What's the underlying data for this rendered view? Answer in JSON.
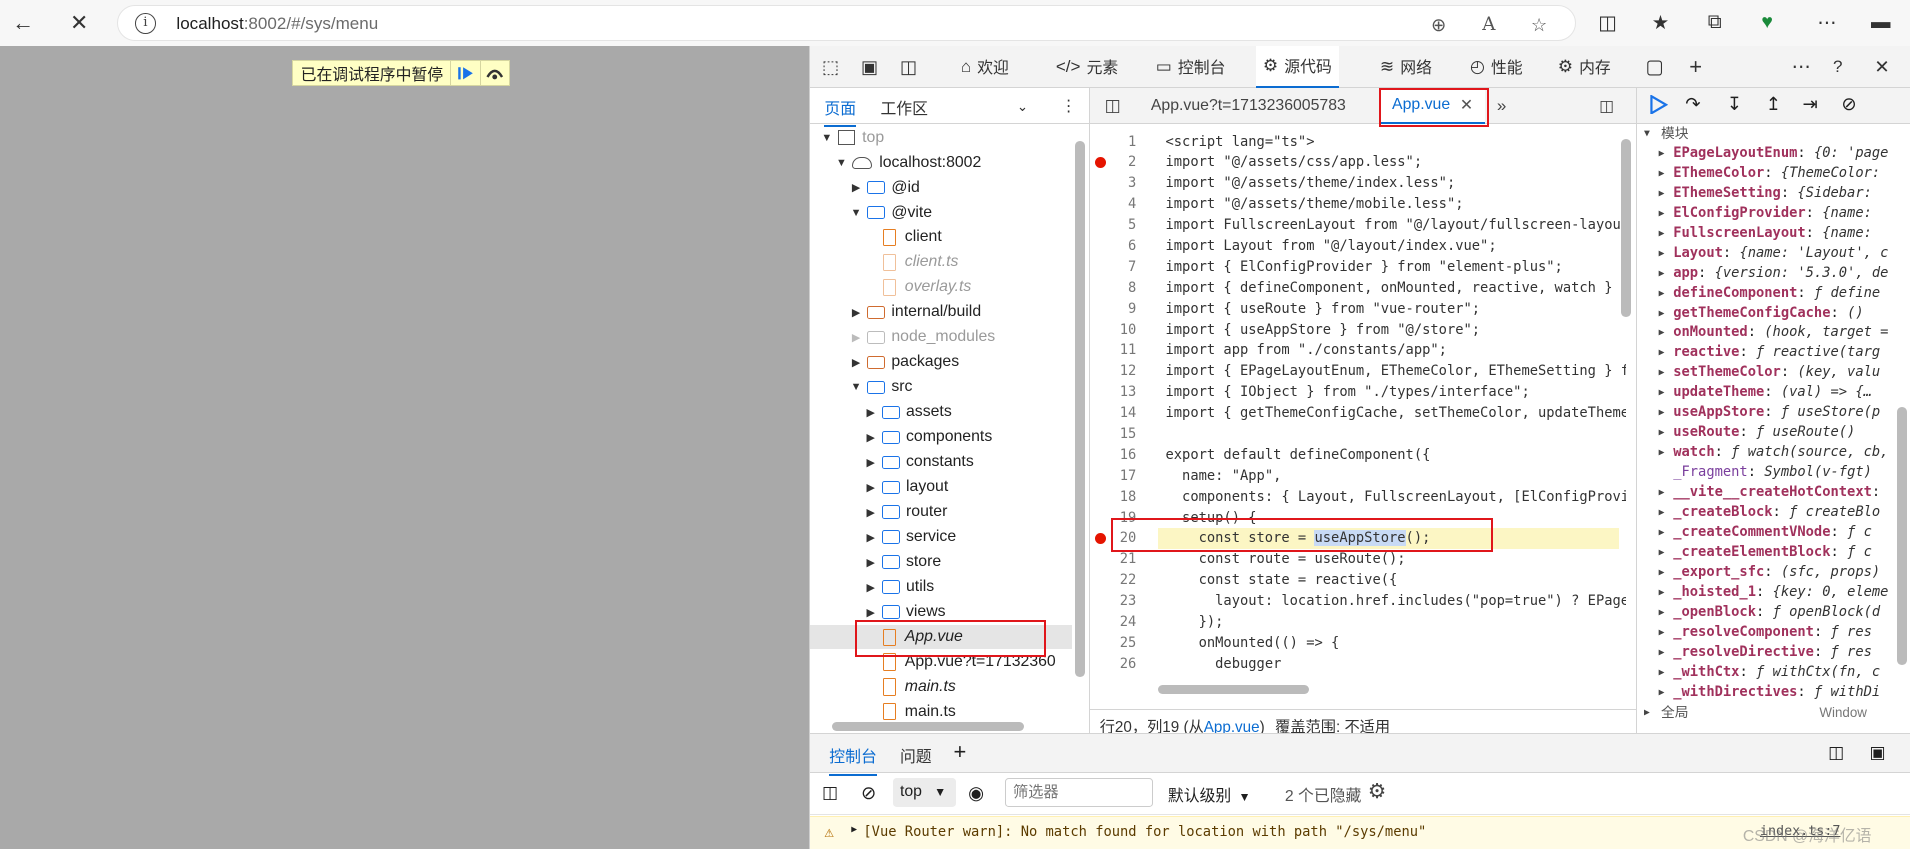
{
  "browser": {
    "url_host": "localhost",
    "url_path": ":8002/#/sys/menu",
    "icons": {
      "back": "back-arrow-icon",
      "stop": "close-icon",
      "info": "info-icon"
    }
  },
  "page": {
    "paused_label": "已在调试程序中暂停"
  },
  "devtools": {
    "tabs": [
      {
        "label": "欢迎",
        "icon": "home-icon"
      },
      {
        "label": "元素",
        "icon": "code-icon"
      },
      {
        "label": "控制台",
        "icon": "console-icon"
      },
      {
        "label": "源代码",
        "icon": "sources-icon"
      },
      {
        "label": "网络",
        "icon": "wifi-icon"
      },
      {
        "label": "性能",
        "icon": "performance-icon"
      },
      {
        "label": "内存",
        "icon": "memory-icon"
      }
    ],
    "active_tab": "源代码"
  },
  "navigator": {
    "tabs": [
      "页面",
      "工作区"
    ],
    "tree": [
      {
        "label": "top",
        "type": "frame",
        "depth": 0,
        "arrow": "down"
      },
      {
        "label": "localhost:8002",
        "type": "cloud",
        "depth": 1,
        "arrow": "down"
      },
      {
        "label": "@id",
        "type": "folder",
        "depth": 2,
        "arrow": "right"
      },
      {
        "label": "@vite",
        "type": "folder",
        "depth": 2,
        "arrow": "down"
      },
      {
        "label": "client",
        "type": "file",
        "depth": 3
      },
      {
        "label": "client.ts",
        "type": "file-dim",
        "depth": 3
      },
      {
        "label": "overlay.ts",
        "type": "file-dim",
        "depth": 3
      },
      {
        "label": "internal/build",
        "type": "folder-orange",
        "depth": 2,
        "arrow": "right"
      },
      {
        "label": "node_modules",
        "type": "folder-gray",
        "depth": 2,
        "arrow": "right"
      },
      {
        "label": "packages",
        "type": "folder-orange",
        "depth": 2,
        "arrow": "right"
      },
      {
        "label": "src",
        "type": "folder",
        "depth": 2,
        "arrow": "down"
      },
      {
        "label": "assets",
        "type": "folder",
        "depth": 3,
        "arrow": "right"
      },
      {
        "label": "components",
        "type": "folder",
        "depth": 3,
        "arrow": "right"
      },
      {
        "label": "constants",
        "type": "folder",
        "depth": 3,
        "arrow": "right"
      },
      {
        "label": "layout",
        "type": "folder",
        "depth": 3,
        "arrow": "right"
      },
      {
        "label": "router",
        "type": "folder",
        "depth": 3,
        "arrow": "right"
      },
      {
        "label": "service",
        "type": "folder",
        "depth": 3,
        "arrow": "right"
      },
      {
        "label": "store",
        "type": "folder",
        "depth": 3,
        "arrow": "right"
      },
      {
        "label": "utils",
        "type": "folder",
        "depth": 3,
        "arrow": "right"
      },
      {
        "label": "views",
        "type": "folder",
        "depth": 3,
        "arrow": "right"
      },
      {
        "label": "App.vue",
        "type": "file-italic",
        "depth": 3,
        "selected": true
      },
      {
        "label": "App.vue?t=17132360",
        "type": "file",
        "depth": 3
      },
      {
        "label": "main.ts",
        "type": "file-italic",
        "depth": 3
      },
      {
        "label": "main.ts",
        "type": "file",
        "depth": 3
      }
    ]
  },
  "editor": {
    "tabs": [
      {
        "label": "App.vue?t=1713236005783"
      },
      {
        "label": "App.vue",
        "active": true
      }
    ],
    "lines": [
      {
        "n": "1",
        "text": "<script lang=\"ts\">"
      },
      {
        "n": "2",
        "text": "import \"@/assets/css/app.less\";",
        "bp": true
      },
      {
        "n": "3",
        "text": "import \"@/assets/theme/index.less\";"
      },
      {
        "n": "4",
        "text": "import \"@/assets/theme/mobile.less\";"
      },
      {
        "n": "5",
        "text": "import FullscreenLayout from \"@/layout/fullscreen-layout."
      },
      {
        "n": "6",
        "text": "import Layout from \"@/layout/index.vue\";"
      },
      {
        "n": "7",
        "text": "import { ElConfigProvider } from \"element-plus\";"
      },
      {
        "n": "8",
        "text": "import { defineComponent, onMounted, reactive, watch } f"
      },
      {
        "n": "9",
        "text": "import { useRoute } from \"vue-router\";"
      },
      {
        "n": "10",
        "text": "import { useAppStore } from \"@/store\";"
      },
      {
        "n": "11",
        "text": "import app from \"./constants/app\";"
      },
      {
        "n": "12",
        "text": "import { EPageLayoutEnum, EThemeColor, EThemeSetting } f"
      },
      {
        "n": "13",
        "text": "import { IObject } from \"./types/interface\";"
      },
      {
        "n": "14",
        "text": "import { getThemeConfigCache, setThemeColor, updateTheme"
      },
      {
        "n": "15",
        "text": ""
      },
      {
        "n": "16",
        "text": "export default defineComponent({"
      },
      {
        "n": "17",
        "text": "  name: \"App\","
      },
      {
        "n": "18",
        "text": "  components: { Layout, FullscreenLayout, [ElConfigProvi"
      },
      {
        "n": "19",
        "text": "  setup() {"
      },
      {
        "n": "20",
        "text": "    const store = useAppStore();",
        "bp": true,
        "hl": true
      },
      {
        "n": "21",
        "text": "    const route = useRoute();"
      },
      {
        "n": "22",
        "text": "    const state = reactive({"
      },
      {
        "n": "23",
        "text": "      layout: location.href.includes(\"pop=true\") ? EPageL"
      },
      {
        "n": "24",
        "text": "    });"
      },
      {
        "n": "25",
        "text": "    onMounted(() => {"
      },
      {
        "n": "26",
        "text": "      debugger"
      }
    ],
    "status": {
      "pos": "行20，列19 (从",
      "file": "App.vue",
      "close": ")",
      "coverage": "覆盖范围: 不适用"
    }
  },
  "scope": {
    "module_label": "模块",
    "global_label": "全局",
    "global_value": "Window",
    "items": [
      {
        "name": "EPageLayoutEnum",
        "value": "{0: 'page"
      },
      {
        "name": "EThemeColor",
        "value": "{ThemeColor:"
      },
      {
        "name": "EThemeSetting",
        "value": "{Sidebar:"
      },
      {
        "name": "ElConfigProvider",
        "value": "{name:"
      },
      {
        "name": "FullscreenLayout",
        "value": "{name:"
      },
      {
        "name": "Layout",
        "value": "{name: 'Layout', c"
      },
      {
        "name": "app",
        "value": "{version: '5.3.0', de"
      },
      {
        "name": "defineComponent",
        "value": "ƒ define"
      },
      {
        "name": "getThemeConfigCache",
        "value": "()"
      },
      {
        "name": "onMounted",
        "value": "(hook, target ="
      },
      {
        "name": "reactive",
        "value": "ƒ reactive(targ"
      },
      {
        "name": "setThemeColor",
        "value": "(key, valu"
      },
      {
        "name": "updateTheme",
        "value": "(val) => {…"
      },
      {
        "name": "useAppStore",
        "value": "ƒ useStore(p"
      },
      {
        "name": "useRoute",
        "value": "ƒ useRoute()"
      },
      {
        "name": "watch",
        "value": "ƒ watch(source, cb,"
      },
      {
        "name": "_Fragment",
        "value": "Symbol(v-fgt)",
        "noarrow": true
      },
      {
        "name": "__vite__createHotContext",
        "value": ""
      },
      {
        "name": "_createBlock",
        "value": "ƒ createBlo"
      },
      {
        "name": "_createCommentVNode",
        "value": "ƒ c"
      },
      {
        "name": "_createElementBlock",
        "value": "ƒ c"
      },
      {
        "name": "_export_sfc",
        "value": "(sfc, props)"
      },
      {
        "name": "_hoisted_1",
        "value": "{key: 0, eleme"
      },
      {
        "name": "_openBlock",
        "value": "ƒ openBlock(d"
      },
      {
        "name": "_resolveComponent",
        "value": "ƒ res"
      },
      {
        "name": "_resolveDirective",
        "value": "ƒ res"
      },
      {
        "name": "_withCtx",
        "value": "ƒ withCtx(fn, c"
      },
      {
        "name": "_withDirectives",
        "value": "ƒ withDi"
      }
    ]
  },
  "console": {
    "tabs": [
      "控制台",
      "问题"
    ],
    "context": "top",
    "filter_placeholder": "筛选器",
    "level": "默认级别",
    "hidden": "2 个已隐藏",
    "warning": "[Vue Router warn]: No match found for location with path \"/sys/menu\"",
    "source_link": "index.ts:7",
    "watermark": "CSDN @海洋亿语"
  },
  "colors": {
    "accent": "#0b6cd1",
    "highlight": "#fcf6c4",
    "breakpoint": "#e51400",
    "annotation": "#e0161b"
  }
}
